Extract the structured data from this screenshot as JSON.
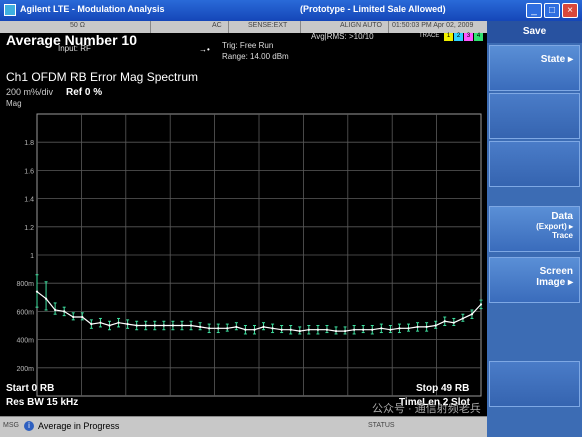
{
  "window": {
    "app_title": "Agilent LTE - Modulation Analysis",
    "center_title": "(Prototype - Limited Sale Allowed)"
  },
  "indicators": {
    "left": "50 Ω",
    "ac": "AC",
    "sense": "SENSE:EXT",
    "align": "ALIGN AUTO",
    "datetime": "01:50:03 PM Apr 02, 2009"
  },
  "header": {
    "measurement": "Average Number  10",
    "input": "Input: RF",
    "trig": "Trig: Free Run",
    "range": "Range: 14.00 dBm",
    "avg": "Avg|RMS: >10/10",
    "trace_label": "TRACE",
    "trace_boxes": [
      "1",
      "2",
      "3",
      "4"
    ]
  },
  "plot": {
    "title": "Ch1 OFDM RB Error Mag Spectrum",
    "scale": "200 m%/div",
    "ref": "Ref 0 %",
    "ylabel": "Mag",
    "start": "Start 0  RB",
    "stop": "Stop 49  RB",
    "res_bw": "Res BW 15 kHz",
    "time_len": "TimeLen 2  Slot"
  },
  "chart_data": {
    "type": "line",
    "title": "Ch1 OFDM RB Error Mag Spectrum",
    "xlabel": "",
    "ylabel": "Mag",
    "xlim": [
      0,
      49
    ],
    "ylim": [
      0,
      2
    ],
    "y_ticks": [
      "1.8",
      "1.6",
      "1.4",
      "1.2",
      "1",
      "800m",
      "600m",
      "400m",
      "200m"
    ],
    "y_tick_values": [
      1.8,
      1.6,
      1.4,
      1.2,
      1.0,
      0.8,
      0.6,
      0.4,
      0.2
    ],
    "grid": true,
    "x": [
      0,
      1,
      2,
      3,
      4,
      5,
      6,
      7,
      8,
      9,
      10,
      11,
      12,
      13,
      14,
      15,
      16,
      17,
      18,
      19,
      20,
      21,
      22,
      23,
      24,
      25,
      26,
      27,
      28,
      29,
      30,
      31,
      32,
      33,
      34,
      35,
      36,
      37,
      38,
      39,
      40,
      41,
      42,
      43,
      44,
      45,
      46,
      47,
      48,
      49
    ],
    "series": [
      {
        "values": [
          0.74,
          0.69,
          0.61,
          0.6,
          0.56,
          0.56,
          0.51,
          0.52,
          0.5,
          0.52,
          0.51,
          0.5,
          0.5,
          0.5,
          0.5,
          0.5,
          0.5,
          0.5,
          0.49,
          0.48,
          0.48,
          0.48,
          0.49,
          0.47,
          0.47,
          0.49,
          0.48,
          0.47,
          0.47,
          0.46,
          0.47,
          0.47,
          0.47,
          0.46,
          0.46,
          0.47,
          0.47,
          0.47,
          0.48,
          0.47,
          0.48,
          0.48,
          0.49,
          0.49,
          0.5,
          0.53,
          0.52,
          0.55,
          0.58,
          0.65
        ],
        "err_low": [
          0.63,
          0.61,
          0.58,
          0.57,
          0.54,
          0.54,
          0.48,
          0.49,
          0.47,
          0.49,
          0.48,
          0.47,
          0.47,
          0.47,
          0.47,
          0.47,
          0.47,
          0.47,
          0.47,
          0.45,
          0.45,
          0.46,
          0.47,
          0.44,
          0.44,
          0.47,
          0.45,
          0.45,
          0.44,
          0.44,
          0.44,
          0.44,
          0.45,
          0.44,
          0.44,
          0.44,
          0.45,
          0.44,
          0.45,
          0.45,
          0.45,
          0.46,
          0.46,
          0.46,
          0.48,
          0.5,
          0.5,
          0.53,
          0.55,
          0.62
        ],
        "err_high": [
          0.86,
          0.81,
          0.66,
          0.63,
          0.59,
          0.59,
          0.54,
          0.55,
          0.53,
          0.55,
          0.54,
          0.53,
          0.53,
          0.53,
          0.53,
          0.53,
          0.53,
          0.53,
          0.52,
          0.51,
          0.51,
          0.51,
          0.52,
          0.5,
          0.5,
          0.52,
          0.51,
          0.5,
          0.5,
          0.49,
          0.5,
          0.5,
          0.5,
          0.49,
          0.49,
          0.5,
          0.5,
          0.5,
          0.51,
          0.5,
          0.51,
          0.51,
          0.52,
          0.52,
          0.53,
          0.56,
          0.55,
          0.58,
          0.61,
          0.68
        ]
      }
    ],
    "colors": {
      "trace": "#ffffff",
      "error_bars": "#3fe0a0",
      "grid": "#5a5a5a"
    }
  },
  "status": {
    "msg_label": "MSG",
    "message": "Average in Progress",
    "status_label": "STATUS"
  },
  "softkeys": {
    "title": "Save",
    "keys": [
      {
        "label1": "State ▸",
        "label2": "",
        "label3": ""
      },
      {
        "label1": "",
        "label2": "",
        "label3": ""
      },
      {
        "label1": "",
        "label2": "",
        "label3": ""
      },
      {
        "label1": "Data",
        "label2": "(Export) ▸",
        "label3": "Trace"
      },
      {
        "label1": "Screen",
        "label2": "Image ▸",
        "label3": ""
      },
      {
        "label1": "",
        "label2": "",
        "label3": ""
      }
    ]
  },
  "watermark": "公众号 · 通信射频老兵"
}
